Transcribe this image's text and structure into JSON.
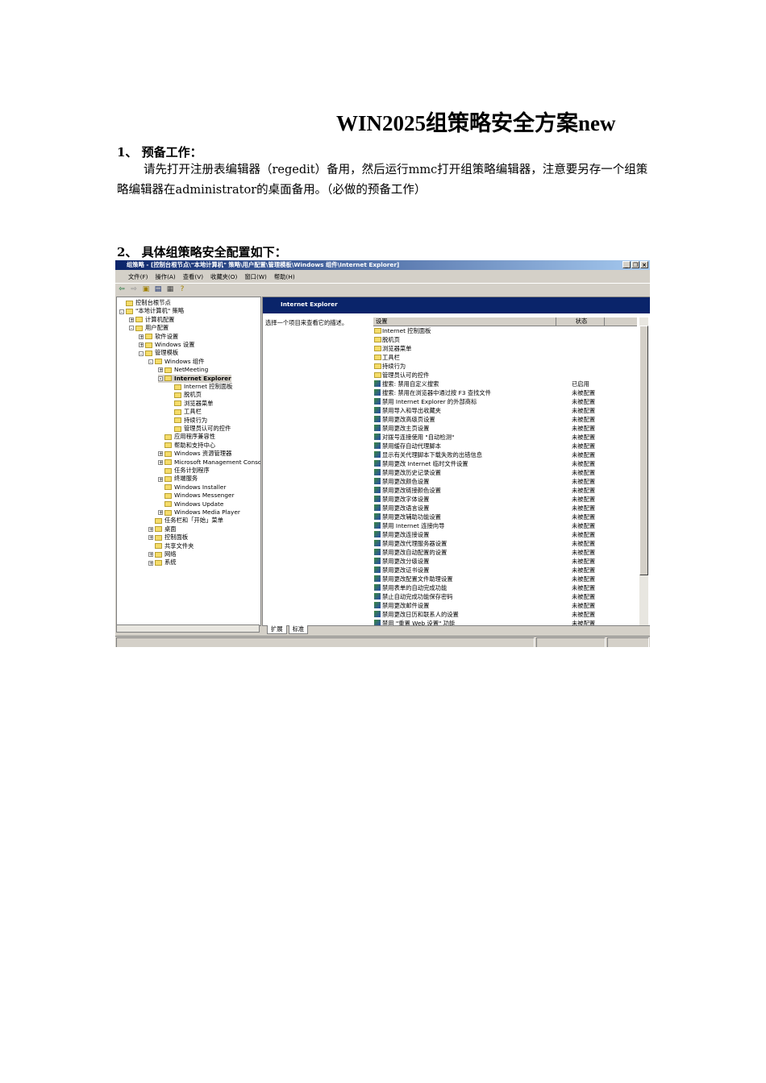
{
  "doc": {
    "title": "WIN2025组策略安全方案new",
    "section1": "1、 预备工作：",
    "para1": "请先打开注册表编辑器（regedit）备用，然后运行mmc打开组策略编辑器，注意要另存一个组策略编辑器在administrator的桌面备用。（必做的预备工作）",
    "section2": "2、 具体组策略安全配置如下："
  },
  "window": {
    "title": "组策略 - [控制台根节点\\\"本地计算机\" 策略\\用户配置\\管理模板\\Windows 组件\\Internet Explorer]",
    "menu": [
      "文件(F)",
      "操作(A)",
      "查看(V)",
      "收藏夹(O)",
      "窗口(W)",
      "帮助(H)"
    ],
    "tree": [
      {
        "l": "控制台根节点",
        "d": 0,
        "pm": ""
      },
      {
        "l": "\"本地计算机\" 策略",
        "d": 0,
        "pm": "-"
      },
      {
        "l": "计算机配置",
        "d": 1,
        "pm": "+"
      },
      {
        "l": "用户配置",
        "d": 1,
        "pm": "-"
      },
      {
        "l": "软件设置",
        "d": 2,
        "pm": "+"
      },
      {
        "l": "Windows 设置",
        "d": 2,
        "pm": "+"
      },
      {
        "l": "管理模板",
        "d": 2,
        "pm": "-"
      },
      {
        "l": "Windows 组件",
        "d": 3,
        "pm": "-"
      },
      {
        "l": "NetMeeting",
        "d": 4,
        "pm": "+"
      },
      {
        "l": "Internet Explorer",
        "d": 4,
        "pm": "-",
        "sel": true
      },
      {
        "l": "Internet 控制面板",
        "d": 5,
        "pm": ""
      },
      {
        "l": "脱机页",
        "d": 5,
        "pm": ""
      },
      {
        "l": "浏览器菜单",
        "d": 5,
        "pm": ""
      },
      {
        "l": "工具栏",
        "d": 5,
        "pm": ""
      },
      {
        "l": "持续行为",
        "d": 5,
        "pm": ""
      },
      {
        "l": "管理员认可的控件",
        "d": 5,
        "pm": ""
      },
      {
        "l": "应用程序兼容性",
        "d": 4,
        "pm": ""
      },
      {
        "l": "帮助和支持中心",
        "d": 4,
        "pm": ""
      },
      {
        "l": "Windows 资源管理器",
        "d": 4,
        "pm": "+"
      },
      {
        "l": "Microsoft Management Console",
        "d": 4,
        "pm": "+"
      },
      {
        "l": "任务计划程序",
        "d": 4,
        "pm": ""
      },
      {
        "l": "终端服务",
        "d": 4,
        "pm": "+"
      },
      {
        "l": "Windows Installer",
        "d": 4,
        "pm": ""
      },
      {
        "l": "Windows Messenger",
        "d": 4,
        "pm": ""
      },
      {
        "l": "Windows Update",
        "d": 4,
        "pm": ""
      },
      {
        "l": "Windows Media Player",
        "d": 4,
        "pm": "+"
      },
      {
        "l": "任务栏和「开始」菜单",
        "d": 3,
        "pm": ""
      },
      {
        "l": "桌面",
        "d": 3,
        "pm": "+"
      },
      {
        "l": "控制面板",
        "d": 3,
        "pm": "+"
      },
      {
        "l": "共享文件夹",
        "d": 3,
        "pm": ""
      },
      {
        "l": "网络",
        "d": 3,
        "pm": "+"
      },
      {
        "l": "系统",
        "d": 3,
        "pm": "+"
      }
    ],
    "pane_title": "Internet Explorer",
    "description": "选择一个项目来查看它的描述。",
    "col_setting": "设置",
    "col_state": "状态",
    "folders": [
      "Internet 控制面板",
      "脱机页",
      "浏览器菜单",
      "工具栏",
      "持续行为",
      "管理员认可的控件"
    ],
    "settings": [
      [
        "搜索: 禁用自定义搜索",
        "已启用"
      ],
      [
        "搜索: 禁用在浏览器中通过按 F3 查找文件",
        "未被配置"
      ],
      [
        "禁用 Internet Explorer 的外部商标",
        "未被配置"
      ],
      [
        "禁用导入和导出收藏夹",
        "未被配置"
      ],
      [
        "禁用更改高级页设置",
        "未被配置"
      ],
      [
        "禁用更改主页设置",
        "未被配置"
      ],
      [
        "对拨号连接使用 \"自动检测\"",
        "未被配置"
      ],
      [
        "禁用缓存自动代理脚本",
        "未被配置"
      ],
      [
        "显示有关代理脚本下载失败的出错信息",
        "未被配置"
      ],
      [
        "禁用更改 Internet 临时文件设置",
        "未被配置"
      ],
      [
        "禁用更改历史记录设置",
        "未被配置"
      ],
      [
        "禁用更改颜色设置",
        "未被配置"
      ],
      [
        "禁用更改链接颜色设置",
        "未被配置"
      ],
      [
        "禁用更改字体设置",
        "未被配置"
      ],
      [
        "禁用更改语言设置",
        "未被配置"
      ],
      [
        "禁用更改辅助功能设置",
        "未被配置"
      ],
      [
        "禁用 Internet 连接向导",
        "未被配置"
      ],
      [
        "禁用更改连接设置",
        "未被配置"
      ],
      [
        "禁用更改代理服务器设置",
        "未被配置"
      ],
      [
        "禁用更改自动配置的设置",
        "未被配置"
      ],
      [
        "禁用更改分级设置",
        "未被配置"
      ],
      [
        "禁用更改证书设置",
        "未被配置"
      ],
      [
        "禁用更改配置文件助理设置",
        "未被配置"
      ],
      [
        "禁用表单的自动完成功能",
        "未被配置"
      ],
      [
        "禁止自动完成功能保存密码",
        "未被配置"
      ],
      [
        "禁用更改邮件设置",
        "未被配置"
      ],
      [
        "禁用更改日历和联系人的设置",
        "未被配置"
      ],
      [
        "禁用 \"重置 Web 设置\" 功能",
        "未被配置"
      ]
    ],
    "tabs": [
      "扩展",
      "标准"
    ]
  }
}
